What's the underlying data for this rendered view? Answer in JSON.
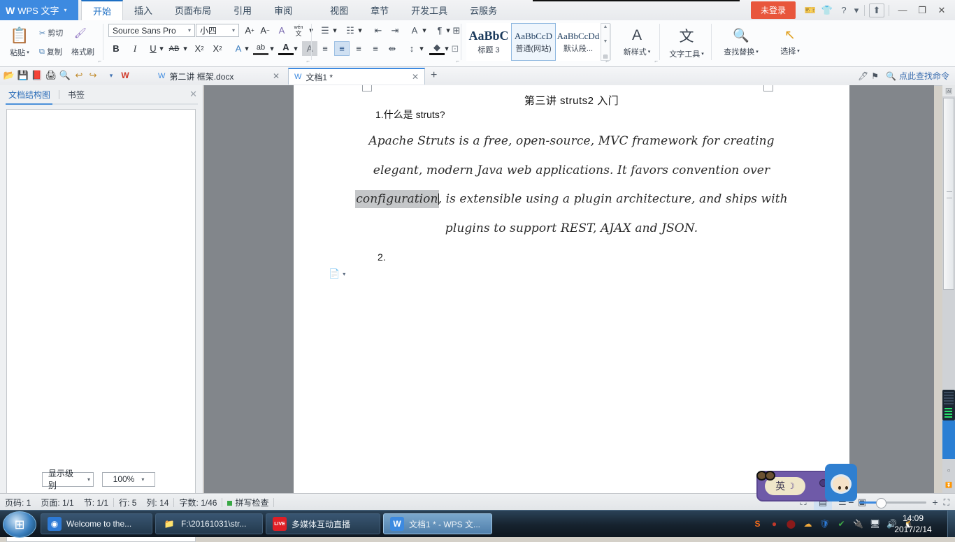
{
  "titlebar": {
    "app_name": "WPS 文字",
    "logo_mark": "W",
    "caret": "▾",
    "ribbon_tabs": [
      {
        "label": "开始",
        "active": true
      },
      {
        "label": "插入",
        "active": false
      },
      {
        "label": "页面布局",
        "active": false
      },
      {
        "label": "引用",
        "active": false
      },
      {
        "label": "审阅",
        "active": false
      },
      {
        "label": "视图",
        "active": false
      },
      {
        "label": "章节",
        "active": false
      },
      {
        "label": "开发工具",
        "active": false
      },
      {
        "label": "云服务",
        "active": false
      }
    ],
    "login_label": "未登录",
    "icons": {
      "coupon": "🎫",
      "shirt": "👕",
      "help": "?",
      "help_caret": "▾",
      "share": "⬆",
      "minimize": "—",
      "restore": "❐",
      "close": "✕"
    }
  },
  "ribbon": {
    "clipboard": {
      "paste_label": "粘贴",
      "paste_caret": "▾",
      "cut_label": "剪切",
      "copy_label": "复制",
      "format_painter_label": "格式刷",
      "dialog_launcher": "⌐"
    },
    "font": {
      "family_value": "Source Sans Pro",
      "size_value": "小四",
      "caret": "▾",
      "grow_label": "A",
      "grow_sup": "+",
      "shrink_label": "A",
      "shrink_sup": "−",
      "clear_format": "A",
      "pinyin_label": "wén",
      "pinyin_label2": "文",
      "bold": "B",
      "italic": "I",
      "underline": "U",
      "strike": "AB",
      "superscript": "X",
      "superscript_sup": "2",
      "subscript": "X",
      "subscript_sub": "2",
      "char_border": "A",
      "highlight": "ab",
      "font_color": "A",
      "char_shading": "A",
      "dialog_launcher": "⌐"
    },
    "paragraph": {
      "bullets": "☰",
      "numbering": "☷",
      "decrease_indent": "⇤",
      "increase_indent": "⇥",
      "sort": "A",
      "show_marks": "¶",
      "borders": "⊞",
      "align_left": "≡",
      "align_center": "≡",
      "align_right": "≡",
      "align_justify": "≡",
      "distribute": "⇹",
      "line_spacing": "↕",
      "shading": "◆",
      "border_menu": "⊡",
      "caret": "▾",
      "dialog_launcher": "⌐"
    },
    "styles": {
      "items": [
        {
          "sample": "AaBbC",
          "name": "标题 3",
          "selected": false,
          "big": true
        },
        {
          "sample": "AaBbCcD",
          "name": "普通(网站)",
          "selected": true,
          "big": false
        },
        {
          "sample": "AaBbCcDd",
          "name": "默认段...",
          "selected": false,
          "big": false
        }
      ],
      "scroll_up": "▲",
      "scroll_down": "▼",
      "scroll_more": "▤",
      "dialog_launcher": "⌐"
    },
    "new_style": {
      "label": "新样式",
      "caret": "▾",
      "icon": "A"
    },
    "text_tool": {
      "label": "文字工具",
      "caret": "▾",
      "icon": "文"
    },
    "find_replace": {
      "label": "查找替换",
      "caret": "▾",
      "icon": "ab"
    },
    "select": {
      "label": "选择",
      "caret": "▾",
      "icon": "↖"
    }
  },
  "quickbar": {
    "icons": [
      {
        "name": "open-icon",
        "glyph": "📂"
      },
      {
        "name": "save-icon",
        "glyph": "💾"
      },
      {
        "name": "export-pdf-icon",
        "glyph": "📕"
      },
      {
        "name": "print-icon",
        "glyph": "🖨"
      },
      {
        "name": "print-preview-icon",
        "glyph": "🔍"
      },
      {
        "name": "undo-icon",
        "glyph": "↩"
      },
      {
        "name": "redo-icon",
        "glyph": "↪"
      },
      {
        "name": "customize-caret-icon",
        "glyph": "▾"
      }
    ],
    "doc_tabs": [
      {
        "label": "第二讲 框架.docx",
        "active": false,
        "close": "✕",
        "icon": "W"
      },
      {
        "label": "文档1 *",
        "active": true,
        "close": "✕",
        "icon": "W"
      }
    ],
    "new_tab": "+",
    "right_icons": [
      {
        "name": "ink-icon",
        "glyph": "🖊"
      },
      {
        "name": "flag-icon",
        "glyph": "⚑"
      }
    ],
    "find_command_placeholder": "点此查找命令",
    "search_icon": "🔍"
  },
  "navpane": {
    "tabs": [
      {
        "label": "文档结构图",
        "active": true
      },
      {
        "label": "书签",
        "active": false
      }
    ],
    "close": "✕",
    "level_combo": {
      "value": "显示级别",
      "caret": "▾"
    },
    "zoom_combo": {
      "value": "100%",
      "caret": "▾"
    }
  },
  "document": {
    "title": "第三讲 struts2 入门",
    "heading": "1.什么是 struts?",
    "body_lines": [
      "Apache Struts is a free, open-source, MVC framework for creating",
      "elegant, modern Java web applications. It favors convention over",
      "configuration, is extensible using a plugin architecture, and ships with",
      "plugins to support REST, AJAX and JSON."
    ],
    "selected_text": "configuration",
    "item2": "2.",
    "paste_options_icon": "📄",
    "paste_options_caret": "▾"
  },
  "scrollbar": {
    "page_thumb_icon": "🖼",
    "up_arrow": "▲",
    "down_arrow": "▼",
    "prev_page": "⏫",
    "select_object": "○",
    "next_page": "⏬"
  },
  "statusbar": {
    "page_num": "页码: 1",
    "page_count": "页面: 1/1",
    "section": "节: 1/1",
    "line": "行: 5",
    "column": "列: 14",
    "word_count": "字数: 1/46",
    "spellcheck": "拼写检查",
    "view_buttons": [
      {
        "name": "full-screen-view",
        "glyph": "⛶",
        "active": false
      },
      {
        "name": "page-view",
        "glyph": "▤",
        "active": true
      },
      {
        "name": "outline-view",
        "glyph": "☰",
        "active": false
      },
      {
        "name": "web-view",
        "glyph": "▣",
        "active": false
      }
    ],
    "zoom_minus": "−",
    "zoom_plus": "+",
    "fit_page": "⛶",
    "zoom_value": "100%"
  },
  "ime": {
    "mode_label": "英",
    "moon": "☽"
  },
  "taskbar": {
    "start_glyph": "⊞",
    "buttons": [
      {
        "label": "Welcome to the...",
        "icon_name": "chrome-icon",
        "glyph": "◉",
        "icon_bg": "#2d7ad6",
        "active": false
      },
      {
        "label": "F:\\20161031\\str...",
        "icon_name": "folder-icon",
        "glyph": "📁",
        "icon_bg": "transparent",
        "active": false
      },
      {
        "label": "多媒体互动直播",
        "icon_name": "live-icon",
        "glyph": "LIVE",
        "icon_bg": "#e01f26",
        "active": false
      },
      {
        "label": "文档1 * - WPS 文...",
        "icon_name": "wps-icon",
        "glyph": "W",
        "icon_bg": "#3d8ae0",
        "active": true
      }
    ],
    "tray": [
      {
        "name": "sogou-icon",
        "glyph": "S",
        "color": "#f26a1b"
      },
      {
        "name": "ninja-icon",
        "glyph": "●",
        "color": "#c0392b"
      },
      {
        "name": "stop-icon",
        "glyph": "⬤",
        "color": "#8b1a1a"
      },
      {
        "name": "cloud-icon",
        "glyph": "☁",
        "color": "#f0a93c"
      },
      {
        "name": "shield-icon",
        "glyph": "🛡",
        "color": "#2d7ad6"
      },
      {
        "name": "update-icon",
        "glyph": "✔",
        "color": "#9aa0a6"
      },
      {
        "name": "plug-icon",
        "glyph": "🔌",
        "color": "#dfe5ea"
      },
      {
        "name": "network-icon",
        "glyph": "🖥",
        "color": "#dfe5ea"
      },
      {
        "name": "volume-icon",
        "glyph": "🔊",
        "color": "#dfe5ea"
      },
      {
        "name": "qq-icon",
        "glyph": "🐧",
        "color": "#f3c04a"
      }
    ],
    "clock_time": "14:09",
    "clock_date": "2017/2/14"
  }
}
